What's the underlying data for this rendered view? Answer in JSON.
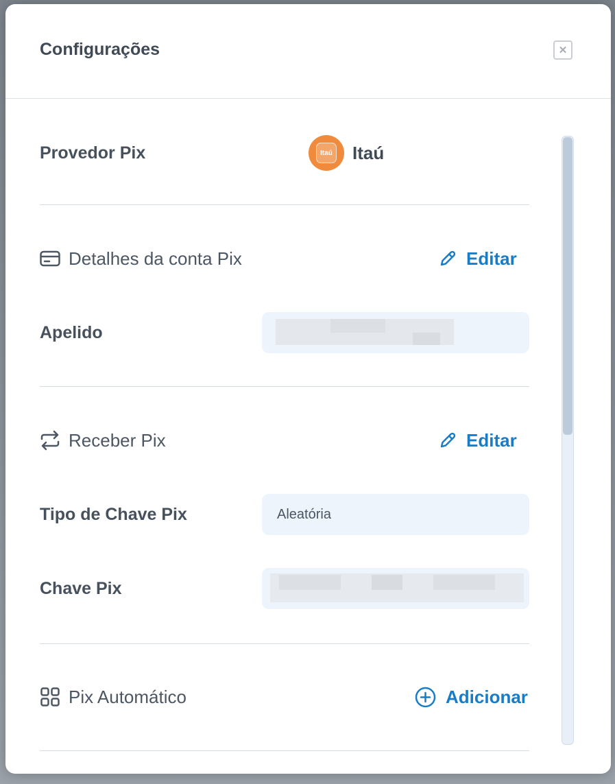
{
  "modal": {
    "title": "Configurações",
    "close_icon": "close-icon"
  },
  "provider": {
    "label": "Provedor Pix",
    "name": "Itaú",
    "logo_text": "Itaú",
    "logo_color": "#f08a3d"
  },
  "account_details": {
    "title": "Detalhes da conta Pix",
    "icon": "credit-card-icon",
    "edit_label": "Editar",
    "edit_icon": "pencil-icon",
    "nickname_label": "Apelido",
    "nickname_value": ""
  },
  "receive": {
    "title": "Receber Pix",
    "icon": "transfer-arrows-icon",
    "edit_label": "Editar",
    "edit_icon": "pencil-icon",
    "key_type_label": "Tipo de Chave Pix",
    "key_type_value": "Aleatória",
    "key_label": "Chave Pix",
    "key_value": ""
  },
  "automatic": {
    "title": "Pix Automático",
    "icon": "grid-icon",
    "add_label": "Adicionar",
    "add_icon": "plus-circle-icon"
  },
  "colors": {
    "accent": "#1a7cc4",
    "field_bg": "#eef4fb",
    "text": "#46515d"
  }
}
